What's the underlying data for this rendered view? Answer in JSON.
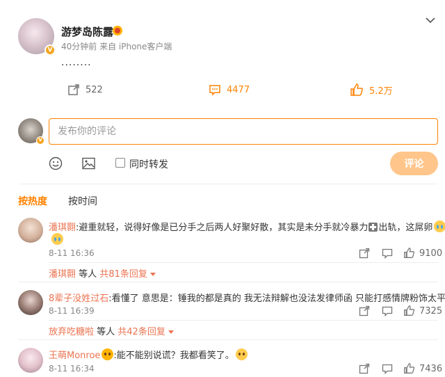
{
  "post": {
    "author": "游梦岛陈露",
    "meta": "40分钟前 来自 iPhone客户端",
    "text": "........",
    "forward_count": "522",
    "comment_count": "4477",
    "like_count": "5.2万"
  },
  "composer": {
    "placeholder": "发布你的评论",
    "repost_label": "同时转发",
    "submit_label": "评论"
  },
  "tabs": {
    "hot": "按热度",
    "time": "按时间"
  },
  "comments": [
    {
      "name": "潘琪翾",
      "text_a": ":避重就轻，说得好像是已分手之后两人好聚好散，其实是未分手就冷暴力",
      "text_b": "出轨，这屌卵",
      "date": "8-11 16:36",
      "likes": "9100",
      "reply_name": "潘琪翾",
      "reply_mid": " 等人 ",
      "reply_count": "共81条回复"
    },
    {
      "name": "8辈子没姓过石",
      "text_a": ":看懂了 意思是：锤我的都是真的 我无法辩解也没法发律师函 只能打感情牌粉饰太平了",
      "date": "8-11 16:39",
      "likes": "7325",
      "reply_name": "放弃吃糖啦",
      "reply_mid": " 等人 ",
      "reply_count": "共42条回复"
    },
    {
      "name": "王萌Monroe",
      "text_a": ":能不能别说谎？我都看笑了。",
      "date": "8-11 16:34",
      "likes": "7436"
    }
  ],
  "colors": {
    "accent": "#ff8200",
    "name": "#eb7350",
    "submit_disabled": "#ffc58a"
  }
}
